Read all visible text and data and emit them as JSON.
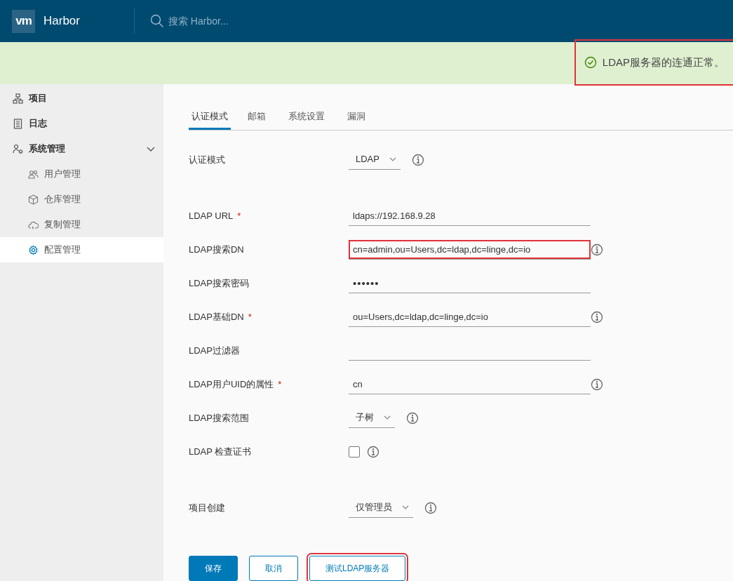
{
  "header": {
    "logo": "vm",
    "title": "Harbor",
    "search": {
      "placeholder": "搜索 Harbor..."
    }
  },
  "banner": {
    "message": "LDAP服务器的连通正常。",
    "highlighted": true
  },
  "sidebar": {
    "items": [
      {
        "label": "项目",
        "selected": false
      },
      {
        "label": "日志",
        "selected": false
      },
      {
        "label": "系统管理",
        "selected": false,
        "expanded": true,
        "children": [
          {
            "label": "用户管理",
            "selected": false
          },
          {
            "label": "仓库管理",
            "selected": false
          },
          {
            "label": "复制管理",
            "selected": false
          },
          {
            "label": "配置管理",
            "selected": true
          }
        ]
      }
    ]
  },
  "tabs": [
    {
      "label": "认证模式",
      "selected": true
    },
    {
      "label": "邮箱",
      "selected": false
    },
    {
      "label": "系统设置",
      "selected": false
    },
    {
      "label": "漏洞",
      "selected": false
    }
  ],
  "sections": [
    {
      "fields": [
        {
          "kind": "select",
          "label": "认证模式",
          "value": "LDAP",
          "info": true
        }
      ]
    },
    {
      "fields": [
        {
          "kind": "text",
          "label": "LDAP URL",
          "required_mark": "*",
          "value": "ldaps://192.168.9.28",
          "info": false,
          "highlighted": false
        },
        {
          "kind": "text",
          "label": "LDAP搜索DN",
          "value": "cn=admin,ou=Users,dc=ldap,dc=linge,dc=io",
          "info": true,
          "highlighted": true
        },
        {
          "kind": "password",
          "label": "LDAP搜索密码",
          "value": "••••••",
          "info": false,
          "highlighted": false
        },
        {
          "kind": "text",
          "label": "LDAP基础DN",
          "required_mark": "*",
          "value": "ou=Users,dc=ldap,dc=linge,dc=io",
          "info": true,
          "highlighted": false
        },
        {
          "kind": "text",
          "label": "LDAP过滤器",
          "info": false,
          "highlighted": false
        },
        {
          "kind": "text",
          "label": "LDAP用户UID的属性",
          "required_mark": "*",
          "value": "cn",
          "info": true,
          "highlighted": false
        },
        {
          "kind": "select",
          "label": "LDAP搜索范围",
          "value": "子树",
          "info": true
        },
        {
          "kind": "checkbox",
          "label": "LDAP 检查证书",
          "checked": false,
          "info": true
        }
      ]
    },
    {
      "fields": [
        {
          "kind": "select",
          "label": "项目创建",
          "value": "仅管理员",
          "info": true
        }
      ]
    }
  ],
  "buttons": [
    {
      "label": "保存",
      "kind": "primary",
      "highlighted": false
    },
    {
      "label": "取消",
      "kind": "outline",
      "highlighted": false
    },
    {
      "label": "测试LDAP服务器",
      "kind": "outline",
      "highlighted": true
    }
  ]
}
